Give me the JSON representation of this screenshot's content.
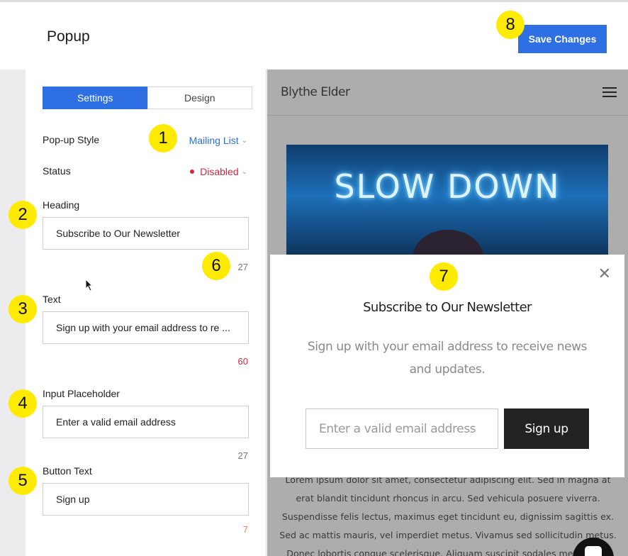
{
  "header": {
    "title": "Popup",
    "save_label": "Save Changes"
  },
  "tabs": [
    {
      "label": "Settings",
      "active": true
    },
    {
      "label": "Design",
      "active": false
    }
  ],
  "settings": {
    "popup_style": {
      "label": "Pop-up Style",
      "value": "Mailing List"
    },
    "status": {
      "label": "Status",
      "value": "Disabled",
      "color": "#d6263b"
    },
    "heading": {
      "label": "Heading",
      "value": "Subscribe to Our Newsletter",
      "count": "27"
    },
    "text": {
      "label": "Text",
      "value": "Sign up with your email address to re ...",
      "count": "60"
    },
    "input_placeholder": {
      "label": "Input Placeholder",
      "value": "Enter a valid email address",
      "count": "27"
    },
    "button_text": {
      "label": "Button Text",
      "value": "Sign up",
      "count": "7"
    }
  },
  "preview": {
    "site_name": "Blythe Elder",
    "hero_text": "SLOW DOWN",
    "lorem": "Lorem ipsum dolor sit amet, consectetur adipiscing elit. Sed in magna at erat blandit tincidunt rhoncus in arcu. Sed vehicula posuere viverra. Suspendisse felis lectus, maximus eget tincidunt eu, dignissim sagittis ex. Sed ac mattis mauris, vel imperdiet metus. Vivamus sed sollicitudin metus. Donec lobortis congue scelerisque. Aliquam suscipit sodales metus. Sed",
    "popup": {
      "heading": "Subscribe to Our Newsletter",
      "text": "Sign up with your email address to receive news and updates.",
      "input_placeholder": "Enter a valid email address",
      "button": "Sign up"
    }
  },
  "callouts": [
    "1",
    "2",
    "3",
    "4",
    "5",
    "6",
    "7",
    "8"
  ],
  "colors": {
    "accent": "#2f6fe4",
    "callout": "#ffeb00",
    "danger": "#d6263b"
  }
}
